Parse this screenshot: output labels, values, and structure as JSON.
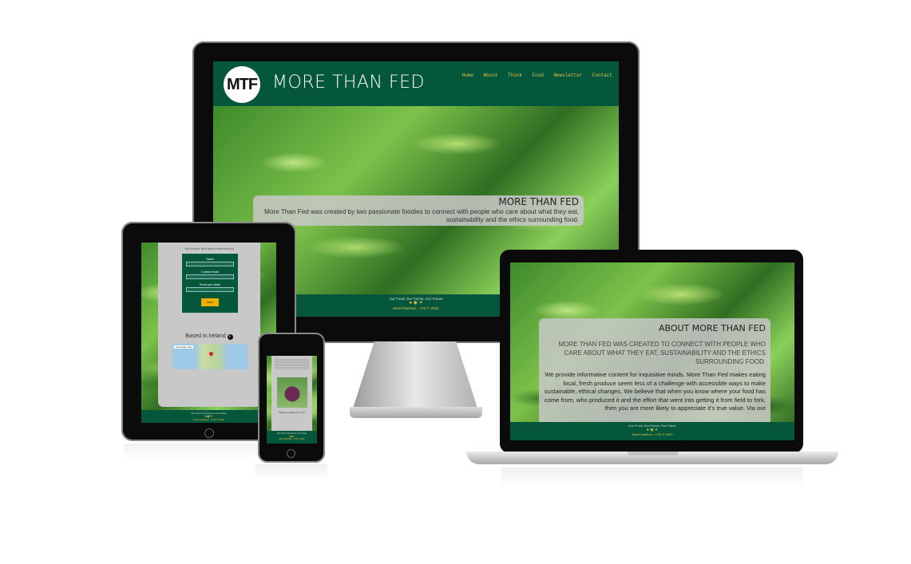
{
  "site": {
    "logo_text": "MTF",
    "title": "MORE THAN FED",
    "nav": [
      "Home",
      "About",
      "Think",
      "Food",
      "Newsletter",
      "Contact"
    ],
    "hero_heading": "MORE THAN FED",
    "hero_text": "More Than Fed was created by two passionate foodies to connect with people who care about what they eat, sustainability and the ethics surrounding food.",
    "footer_tagline": "Our Food; Our Farms; Our Future",
    "footer_social_icons": [
      "facebook-icon",
      "instagram-icon",
      "twitter-icon"
    ],
    "footer_copyright": "MoreThanFed... LTD © 2022"
  },
  "laptop": {
    "heading": "ABOUT MORE THAN FED",
    "subheading": "MORE THAN FED WAS CREATED TO CONNECT WITH PEOPLE WHO CARE ABOUT WHAT THEY EAT, SUSTAINABILITY AND THE ETHICS SURROUNDING FOOD.",
    "body": "We provide informative content for inquisitive minds. More Than Fed makes eating local, fresh produce seem less of a challenge with accessible ways to make sustainable, ethical changes. We believe that when you know where your food has come from, who produced it and the effort that went into getting it from field to fork, then you are more likely to appreciate it's true value. Via our"
  },
  "tablet": {
    "intro": "Get in touch, we'd love to hear from you",
    "form_labels": [
      "Name",
      "Contact Email",
      "Email your ideas"
    ],
    "submit_label": "Send",
    "map_heading": "Based in Ireland",
    "map_button": "View larger map"
  },
  "phone": {
    "caption": "What to expect from you"
  },
  "colors": {
    "brand_green": "#04573a",
    "nav_gold": "#e8c34a",
    "panel_grey": "#c8c8c8",
    "button_gold": "#f0b000"
  }
}
